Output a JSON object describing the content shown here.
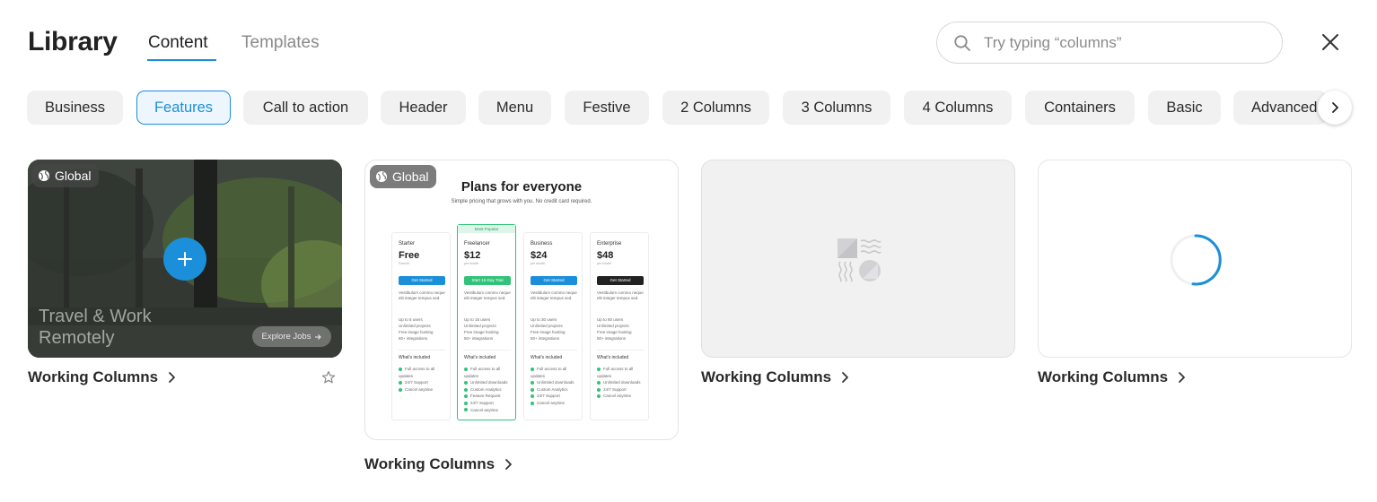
{
  "header": {
    "title": "Library",
    "tabs": [
      {
        "label": "Content",
        "active": true
      },
      {
        "label": "Templates",
        "active": false
      }
    ]
  },
  "search": {
    "placeholder": "Try typing “columns”",
    "icon": "search-icon"
  },
  "close": {
    "icon": "close-icon"
  },
  "categories": [
    "Business",
    "Features",
    "Call to action",
    "Header",
    "Menu",
    "Festive",
    "2 Columns",
    "3 Columns",
    "4 Columns",
    "Containers",
    "Basic",
    "Advanced"
  ],
  "active_category": "Features",
  "colors": {
    "accent": "#1b8fd9",
    "chip_bg": "#f1f1f2",
    "success": "#33c27a"
  },
  "cards": [
    {
      "badge": "Global",
      "title": "Working Columns",
      "preview": {
        "headline_line1": "Travel & Work",
        "headline_line2": "Remotely",
        "cta": "Explore Jobs"
      },
      "starred": false
    },
    {
      "badge": "Global",
      "title": "Working Columns",
      "preview": {
        "heading": "Plans for everyone",
        "subheading": "Simple pricing that grows with you. No credit card required.",
        "plans": [
          {
            "name": "Starter",
            "price": "Free",
            "price_note": "Forever",
            "button": "Get Started",
            "button_color": "#1b8fd9",
            "desc": "Vestibulum commo neque elit integer tempus sed.",
            "features": [
              "Up to 5 users",
              "Unlimited projects",
              "Free image hosting",
              "50+ integrations"
            ],
            "included": [
              "Full access to all updates",
              "24/7 Support",
              "Cancel anytime"
            ]
          },
          {
            "name": "Freelancer",
            "price": "$12",
            "price_note": "per month",
            "badge": "Most Popular",
            "button": "Start 15-Day Trial",
            "button_color": "#33c27a",
            "desc": "Vestibulum commo neque elit integer tempus sed.",
            "features": [
              "Up to 15 users",
              "Unlimited projects",
              "Free image hosting",
              "50+ integrations"
            ],
            "included": [
              "Full access to all updates",
              "Unlimited downloads",
              "Custom Analytics",
              "Feature Request",
              "24/7 Support",
              "Cancel anytime"
            ]
          },
          {
            "name": "Business",
            "price": "$24",
            "price_note": "per month",
            "button": "Get Started",
            "button_color": "#1b8fd9",
            "desc": "Vestibulum commo neque elit integer tempus sed.",
            "features": [
              "Up to 30 users",
              "Unlimited projects",
              "Free image hosting",
              "50+ integrations"
            ],
            "included": [
              "Full access to all updates",
              "Unlimited downloads",
              "Custom Analytics",
              "24/7 Support",
              "Cancel anytime"
            ]
          },
          {
            "name": "Enterprise",
            "price": "$48",
            "price_note": "per month",
            "button": "Get Started",
            "button_color": "#222222",
            "desc": "Vestibulum commo neque elit integer tempus sed.",
            "features": [
              "Up to 60 users",
              "Unlimited projects",
              "Free image hosting",
              "50+ integrations"
            ],
            "included": [
              "Full access to all updates",
              "Unlimited downloads",
              "24/7 Support",
              "Cancel anytime"
            ]
          }
        ],
        "included_label": "What's included"
      }
    },
    {
      "title": "Working Columns",
      "preview_icon": "image-placeholder-icon"
    },
    {
      "title": "Working Columns",
      "preview_icon": "loading-spinner-icon"
    }
  ]
}
